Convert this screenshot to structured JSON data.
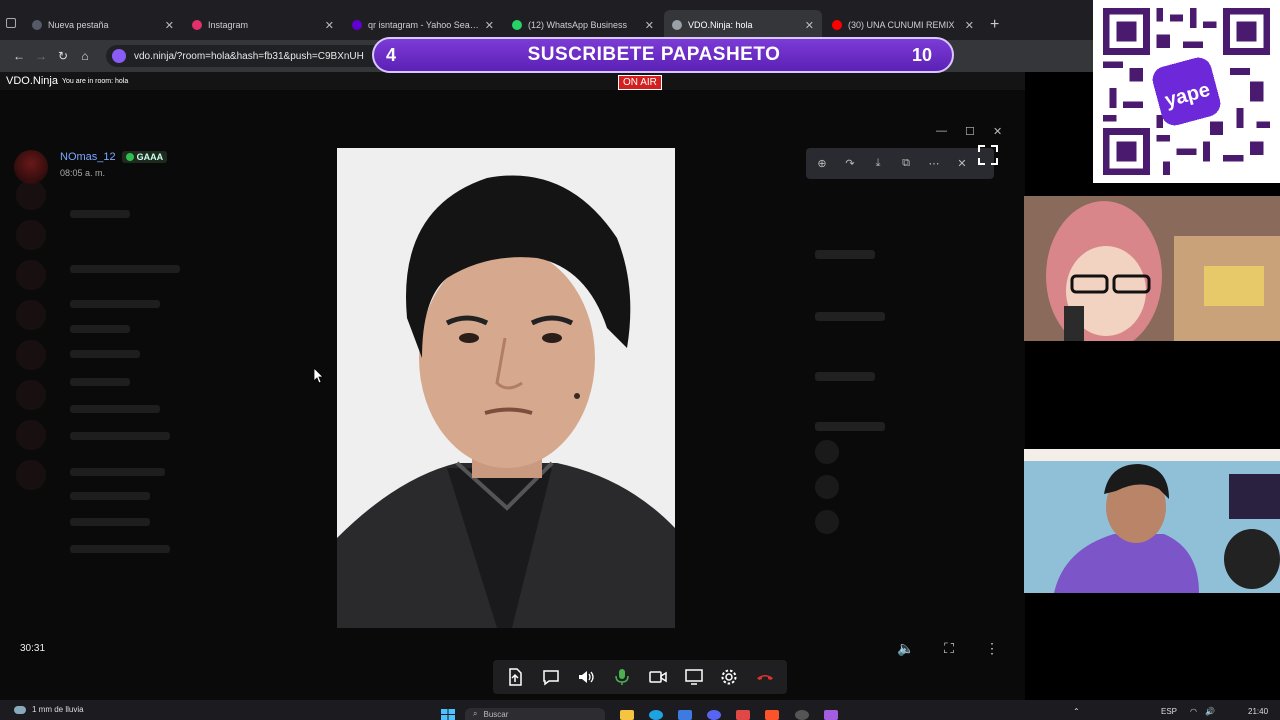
{
  "tabs": [
    {
      "title": "Nueva pestaña",
      "color": "#555a66"
    },
    {
      "title": "Instagram",
      "color": "#e1306c"
    },
    {
      "title": "qr isntagram - Yahoo Search Tu",
      "color": "#6001d2"
    },
    {
      "title": "(12) WhatsApp Business",
      "color": "#25d366"
    },
    {
      "title": "VDO.Ninja: hola",
      "color": "#9aa0a6",
      "active": true
    },
    {
      "title": "(30) UNA CUNUMI REMIX",
      "color": "#ff0000"
    }
  ],
  "address": {
    "url": "vdo.ninja/?room=hola&hash=fb31&push=C9BXnUH"
  },
  "vdo": {
    "brand": "VDO.Ninja",
    "room_text": "You are in room: hola"
  },
  "banner": {
    "left_count": "4",
    "message": "SUSCRIBETE PAPASHETO",
    "right_count": "10",
    "onair": "ON AIR"
  },
  "chat": {
    "username": "NOmas_12",
    "tag": "GAAA",
    "time": "08:05 a. m."
  },
  "player": {
    "timer": "30:31"
  },
  "taskbar": {
    "weather": "1 mm de lluvia",
    "search_placeholder": "Buscar",
    "lang": "ESP",
    "clock": "21:40"
  },
  "colors": {
    "accent": "#6d28d9",
    "hangup": "#e03131",
    "mic": "#4caf50"
  }
}
